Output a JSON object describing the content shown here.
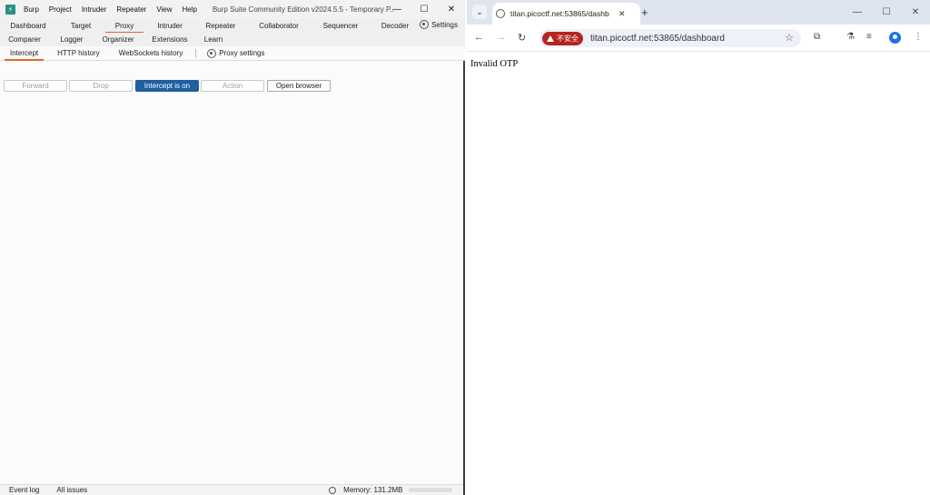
{
  "burp": {
    "menu": [
      "Burp",
      "Project",
      "Intruder",
      "Repeater",
      "View",
      "Help"
    ],
    "window_title": "Burp Suite Community Edition v2024.5.5 - Temporary P...",
    "main_tabs_row1": [
      "Dashboard",
      "Target",
      "Proxy",
      "Intruder",
      "Repeater",
      "Collaborator",
      "Sequencer",
      "Decoder"
    ],
    "main_tabs_row2": [
      "Comparer",
      "Logger",
      "Organizer",
      "Extensions",
      "Learn"
    ],
    "settings_label": "Settings",
    "active_tab": "Proxy",
    "sub_tabs": [
      "Intercept",
      "HTTP history",
      "WebSockets history"
    ],
    "active_sub_tab": "Intercept",
    "proxy_settings_label": "Proxy settings",
    "buttons": {
      "forward": "Forward",
      "drop": "Drop",
      "intercept": "Intercept is on",
      "action": "Action",
      "open_browser": "Open browser"
    },
    "status": {
      "event_log": "Event log",
      "all_issues": "All issues",
      "memory": "Memory: 131.2MB"
    },
    "accent_color": "#e2672b",
    "intercept_color": "#1f5fa0"
  },
  "browser": {
    "tab_title": "titan.picoctf.net:53865/dashb",
    "security_label": "不安全",
    "url": "titan.picoctf.net:53865/dashboard",
    "page_text": "Invalid OTP",
    "insecure_color": "#b3261e"
  }
}
